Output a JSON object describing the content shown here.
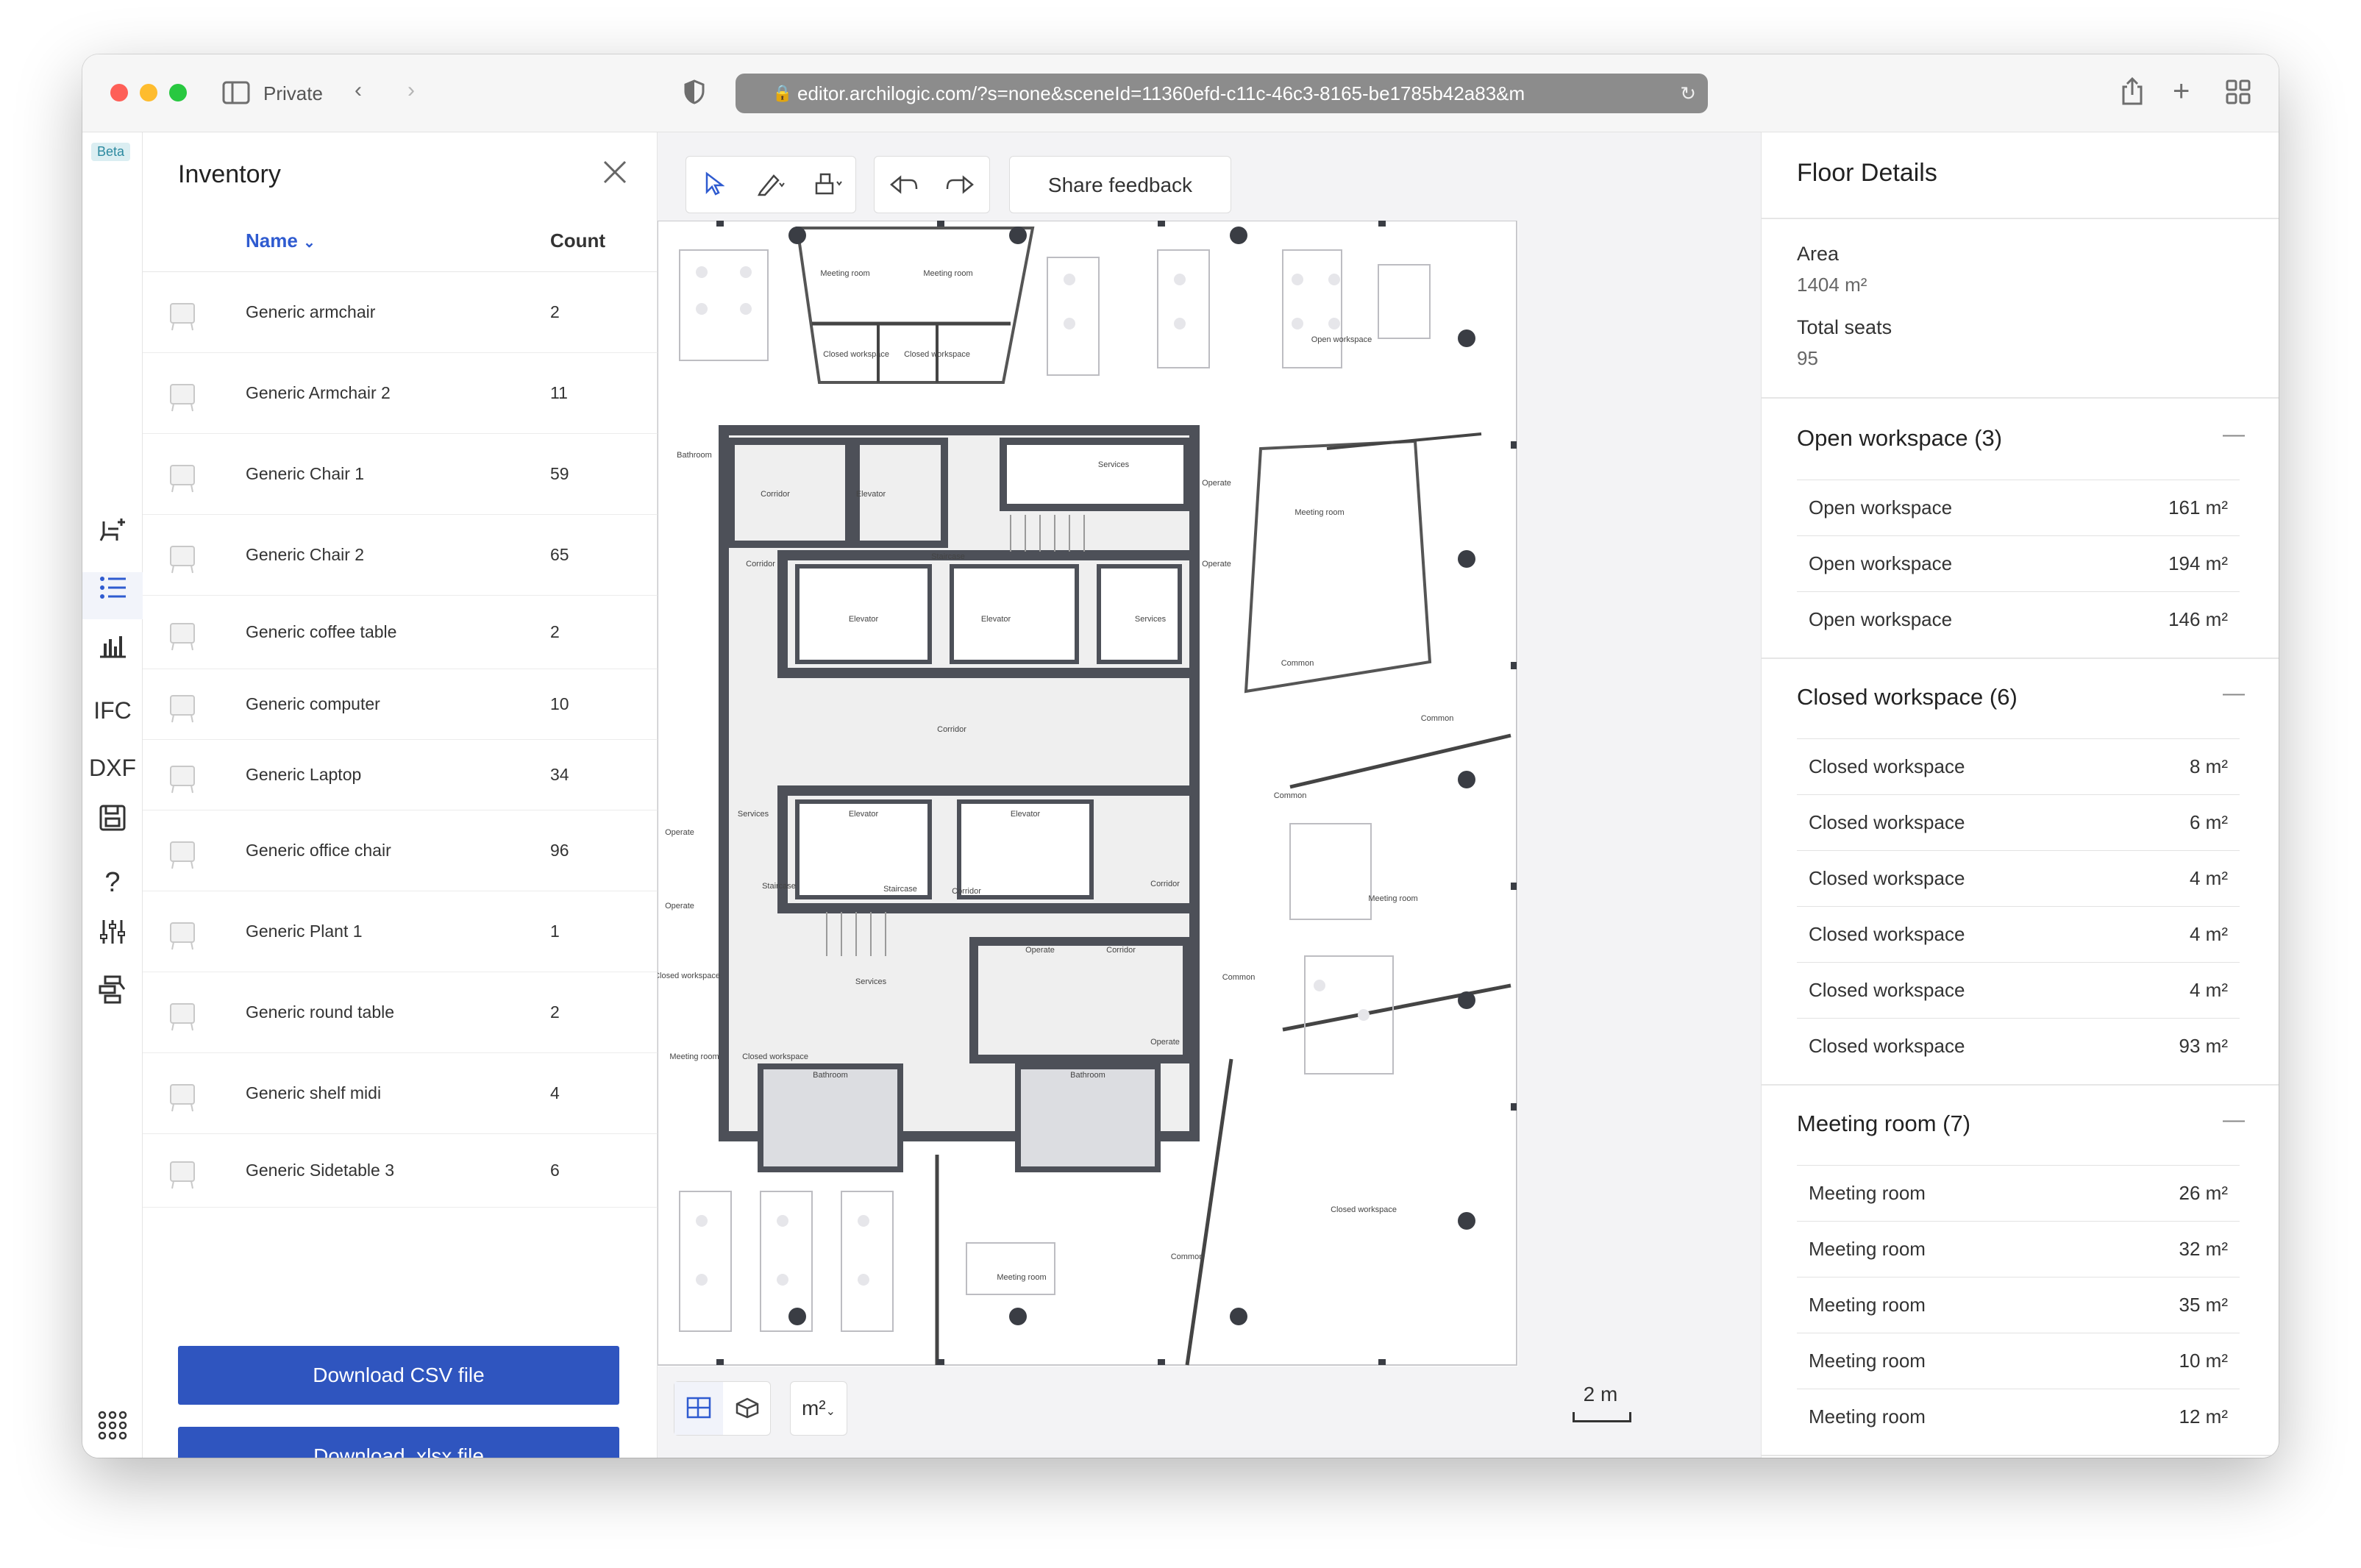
{
  "browser": {
    "mode_label": "Private",
    "url": "editor.archilogic.com/?s=none&sceneId=11360efd-c11c-46c3-8165-be1785b42a83&m"
  },
  "rail": {
    "beta": "Beta",
    "ifc": "IFC",
    "dxf": "DXF"
  },
  "inventory": {
    "title": "Inventory",
    "col_name": "Name",
    "col_count": "Count",
    "items": [
      {
        "name": "Generic armchair",
        "count": "2"
      },
      {
        "name": "Generic Armchair 2",
        "count": "11"
      },
      {
        "name": "Generic Chair 1",
        "count": "59"
      },
      {
        "name": "Generic Chair 2",
        "count": "65"
      },
      {
        "name": "Generic coffee table",
        "count": "2"
      },
      {
        "name": "Generic computer",
        "count": "10"
      },
      {
        "name": "Generic Laptop",
        "count": "34"
      },
      {
        "name": "Generic office chair",
        "count": "96"
      },
      {
        "name": "Generic Plant 1",
        "count": "1"
      },
      {
        "name": "Generic round table",
        "count": "2"
      },
      {
        "name": "Generic shelf midi",
        "count": "4"
      },
      {
        "name": "Generic Sidetable 3",
        "count": "6"
      }
    ],
    "download_csv": "Download CSV file",
    "download_xlsx": "Download .xlsx file"
  },
  "canvas": {
    "share_feedback": "Share feedback",
    "unit": "m²",
    "scale": "2 m",
    "plan_labels": {
      "meeting_room": "Meeting room",
      "closed_workspace": "Closed workspace",
      "open_workspace": "Open workspace",
      "bathroom": "Bathroom",
      "corridor": "Corridor",
      "elevator": "Elevator",
      "services": "Services",
      "operate": "Operate",
      "staircase": "Staircase",
      "common": "Common"
    }
  },
  "details": {
    "title": "Floor Details",
    "area_label": "Area",
    "area_value": "1404 m²",
    "seats_label": "Total seats",
    "seats_value": "95",
    "sections": [
      {
        "title": "Open workspace (3)",
        "rows": [
          {
            "name": "Open workspace",
            "value": "161 m²"
          },
          {
            "name": "Open workspace",
            "value": "194 m²"
          },
          {
            "name": "Open workspace",
            "value": "146 m²"
          }
        ]
      },
      {
        "title": "Closed workspace (6)",
        "rows": [
          {
            "name": "Closed workspace",
            "value": "8 m²"
          },
          {
            "name": "Closed workspace",
            "value": "6 m²"
          },
          {
            "name": "Closed workspace",
            "value": "4 m²"
          },
          {
            "name": "Closed workspace",
            "value": "4 m²"
          },
          {
            "name": "Closed workspace",
            "value": "4 m²"
          },
          {
            "name": "Closed workspace",
            "value": "93 m²"
          }
        ]
      },
      {
        "title": "Meeting room (7)",
        "rows": [
          {
            "name": "Meeting room",
            "value": "26 m²"
          },
          {
            "name": "Meeting room",
            "value": "32 m²"
          },
          {
            "name": "Meeting room",
            "value": "35 m²"
          },
          {
            "name": "Meeting room",
            "value": "10 m²"
          },
          {
            "name": "Meeting room",
            "value": "12 m²"
          }
        ]
      }
    ]
  }
}
